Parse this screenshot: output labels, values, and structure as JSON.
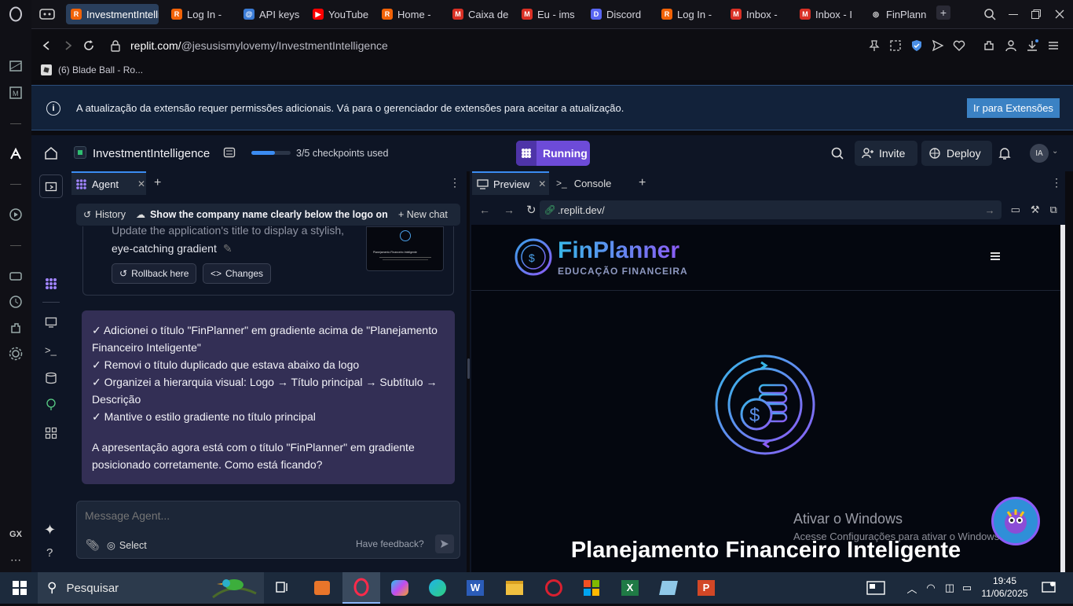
{
  "browser": {
    "tabs": [
      {
        "label": "InvestmentIntelli",
        "color": "#f26207",
        "glyph": "R",
        "active": true
      },
      {
        "label": "Log In -",
        "color": "#f26207",
        "glyph": "R"
      },
      {
        "label": "API keys",
        "color": "#3a7bd5",
        "glyph": "@"
      },
      {
        "label": "YouTube",
        "color": "#ff0000",
        "glyph": "▶"
      },
      {
        "label": "Home -",
        "color": "#f26207",
        "glyph": "R"
      },
      {
        "label": "Caixa de",
        "color": "#d93025",
        "glyph": "M"
      },
      {
        "label": "Eu - ims",
        "color": "#d93025",
        "glyph": "M"
      },
      {
        "label": "Discord",
        "color": "#5865f2",
        "glyph": "D"
      },
      {
        "label": "Log In -",
        "color": "#f26207",
        "glyph": "R"
      },
      {
        "label": "Inbox -",
        "color": "#d93025",
        "glyph": "M"
      },
      {
        "label": "Inbox - I",
        "color": "#d93025",
        "glyph": "M"
      },
      {
        "label": "FinPlann",
        "color": "#ffffff",
        "glyph": "◎"
      }
    ],
    "url_domain": "replit.com/",
    "url_path": "@jesusismylovemy/InvestmentIntelligence",
    "bookmark": "(6) Blade Ball - Ro...",
    "infobar_message": "A atualização da extensão requer permissões adicionais. Vá para o gerenciador de extensões para aceitar a atualização.",
    "infobar_button": "Ir para Extensões"
  },
  "replit": {
    "project_name": "InvestmentIntelligence",
    "checkpoints": "3/5 checkpoints used",
    "checkpoints_fraction": 0.6,
    "run_label": "Running",
    "invite_label": "Invite",
    "deploy_label": "Deploy",
    "avatar": "IA",
    "agent_tab": "Agent",
    "history_label": "History",
    "chat_title": "Show the company name clearly below the logo on th...",
    "new_chat_label": "New chat",
    "prev_message_line1": "Update the application's title to display a stylish,",
    "prev_message_line2": "eye-catching gradient",
    "rollback_label": "Rollback here",
    "changes_label": "Changes",
    "thumb_title": "Planejamento Financeiro Inteligente",
    "agent_lines": [
      "✓ Adicionei o título \"FinPlanner\" em gradiente acima de \"Planejamento Financeiro Inteligente\"",
      "✓ Removi o título duplicado que estava abaixo da logo",
      "✓ Organizei a hierarquia visual: Logo → Título principal → Subtítulo → Descrição",
      "✓ Mantive o estilo gradiente no título principal"
    ],
    "agent_summary": "A apresentação agora está com o título \"FinPlanner\" em gradiente posicionado corretamente. Como está ficando?",
    "input_placeholder": "Message Agent...",
    "select_label": "Select",
    "feedback_label": "Have feedback?",
    "preview_tab": "Preview",
    "console_tab": "Console",
    "preview_url": ".replit.dev/"
  },
  "site": {
    "brand": "FinPlanner",
    "tagline": "EDUCAÇÃO FINANCEIRA",
    "hero_title": "Planejamento Financeiro Inteligente"
  },
  "watermark": {
    "line1": "Ativar o Windows",
    "line2": "Acesse Configurações para ativar o Windows."
  },
  "taskbar": {
    "search_label": "Pesquisar",
    "time": "19:45",
    "date": "11/06/2025"
  },
  "colors": {
    "accent": "#7c5cff",
    "running": "#6d4bd8",
    "extension_button": "#3b82c4"
  }
}
